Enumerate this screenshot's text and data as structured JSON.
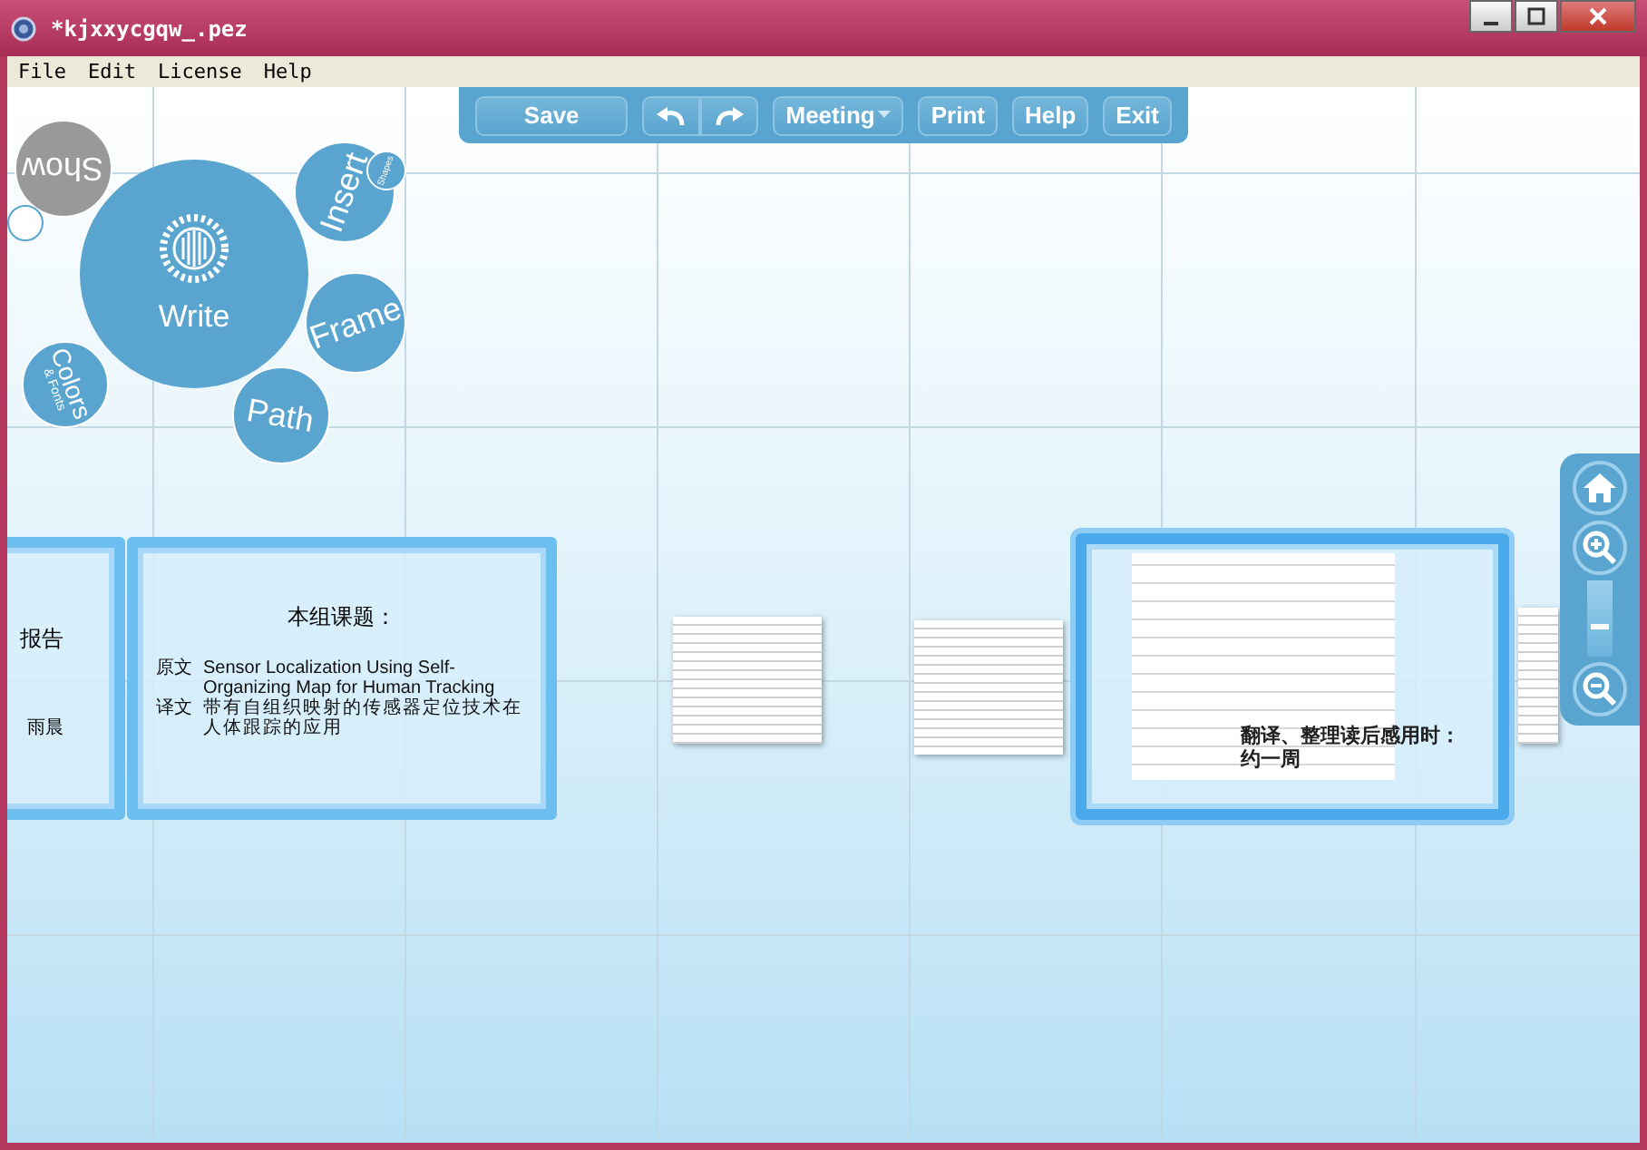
{
  "window": {
    "title": "*kjxxycgqw_.pez"
  },
  "menu": [
    "File",
    "Edit",
    "License",
    "Help"
  ],
  "toolbar": [
    {
      "kind": "text",
      "label": "Save"
    },
    {
      "kind": "undo"
    },
    {
      "kind": "redo"
    },
    {
      "kind": "dropdown",
      "label": "Meeting"
    },
    {
      "kind": "text",
      "label": "Print"
    },
    {
      "kind": "text",
      "label": "Help"
    },
    {
      "kind": "text",
      "label": "Exit"
    }
  ],
  "bubble_menu": {
    "center": "Write",
    "items": [
      {
        "kind": "show",
        "label": "Show"
      },
      {
        "kind": "insert",
        "label": "Insert"
      },
      {
        "kind": "shapes",
        "label": "Shapes"
      },
      {
        "kind": "frame",
        "label": "Frame"
      },
      {
        "kind": "path",
        "label": "Path"
      },
      {
        "kind": "colors",
        "label": "Colors",
        "sublabel": "& Fonts"
      }
    ]
  },
  "frames": [
    {
      "kind": "partial",
      "selected": false,
      "title": "报告",
      "lines": [
        "雨晨"
      ]
    },
    {
      "kind": "text",
      "selected": false,
      "title": "本组课题：",
      "lines": [
        "原文",
        "Sensor Localization Using Self-Organizing Map for Human Tracking",
        "译文",
        "带有自组织映射的传感器定位技术在人体跟踪的应用"
      ]
    },
    {
      "kind": "document",
      "selected": true,
      "title": "翻译、整理读后感用时：约一周"
    }
  ],
  "zoom": {
    "level": 0.35
  }
}
